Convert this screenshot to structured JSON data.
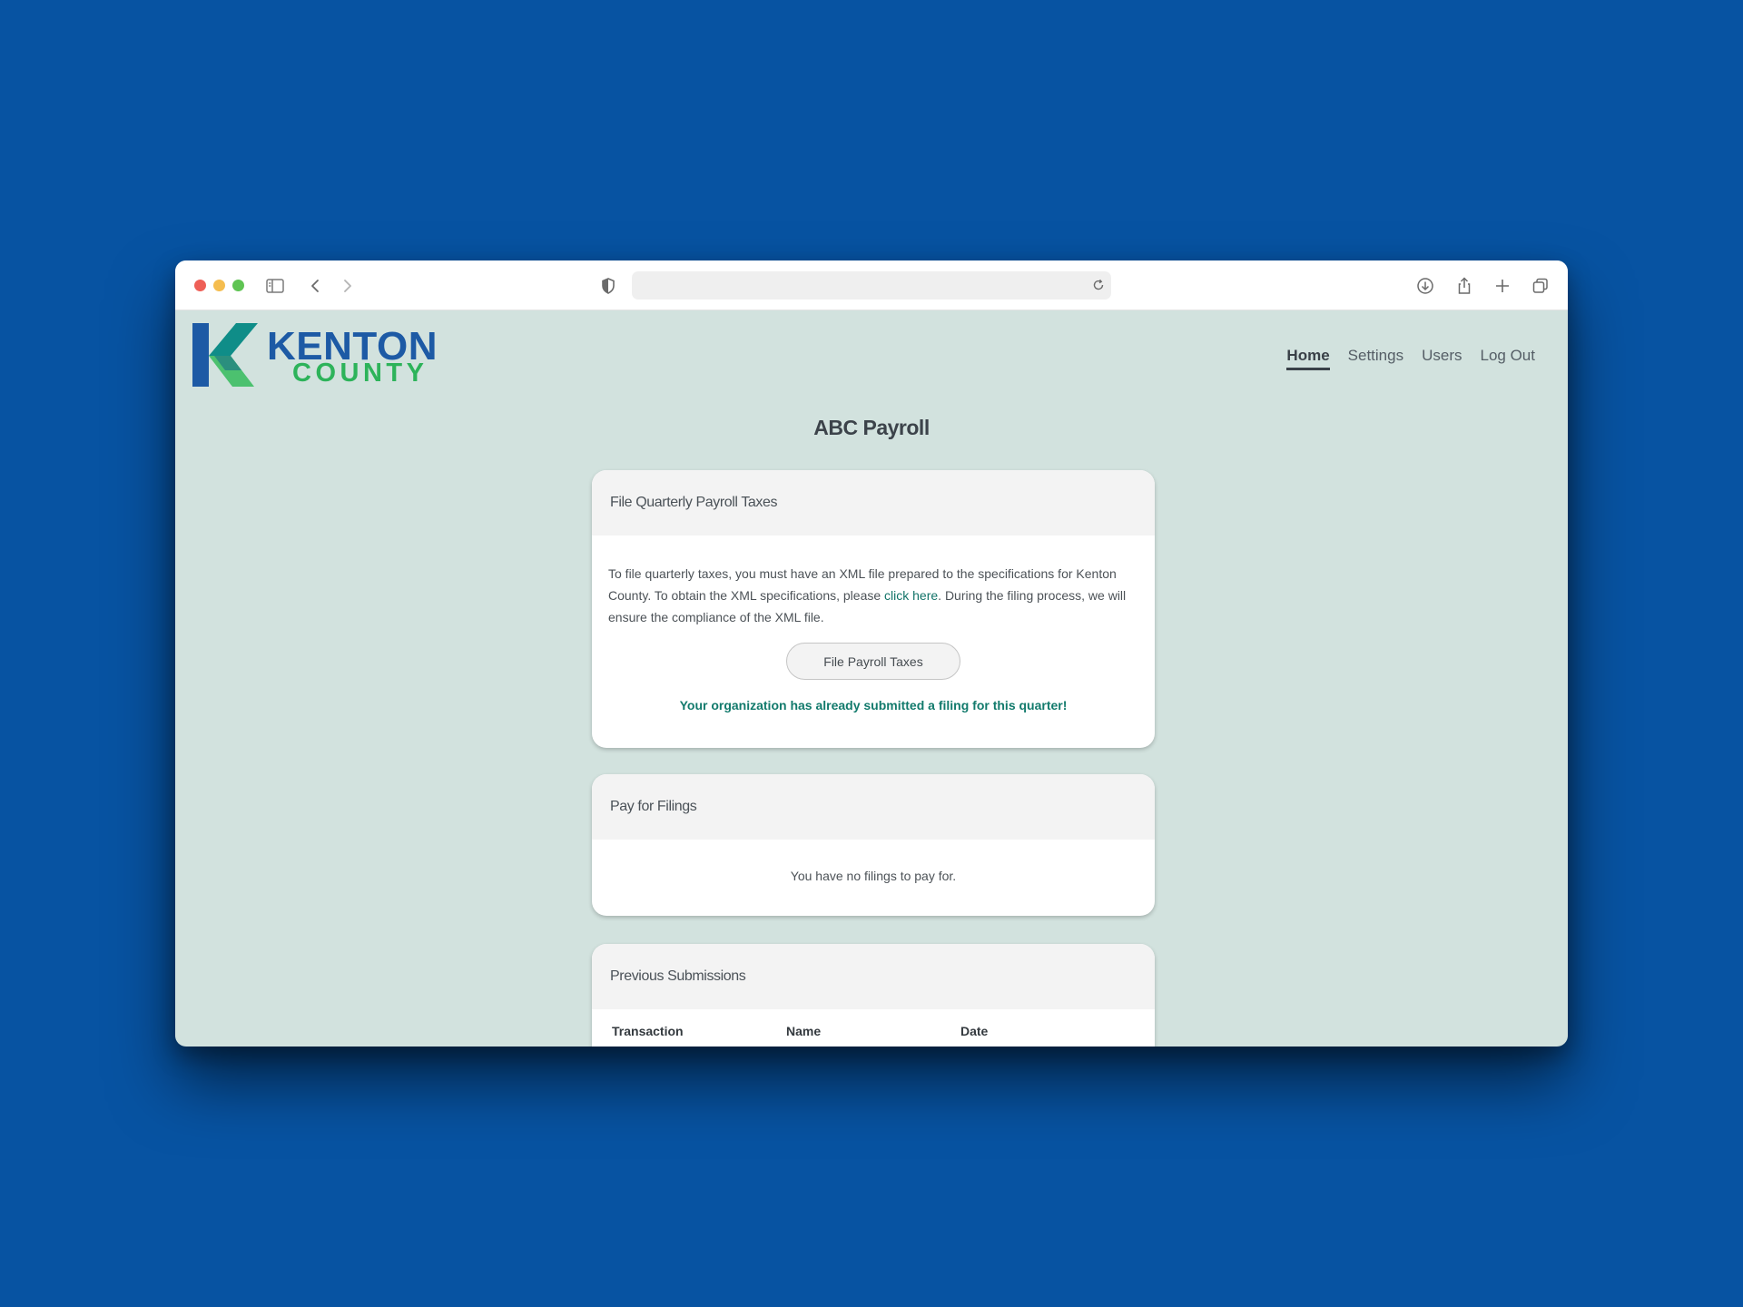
{
  "browser": {
    "url": "",
    "icons": [
      "sidebar-icon",
      "back-icon",
      "forward-icon",
      "shield-icon",
      "reload-icon",
      "download-icon",
      "share-icon",
      "new-tab-icon",
      "tabs-overview-icon"
    ]
  },
  "logo": {
    "line1": "KENTON",
    "line2": "COUNTY",
    "colors": {
      "blue": "#1d5aa5",
      "green": "#2db35a",
      "teal": "#0f8d88"
    }
  },
  "nav": {
    "home": "Home",
    "settings": "Settings",
    "users": "Users",
    "logout": "Log Out"
  },
  "page": {
    "title": "ABC Payroll"
  },
  "file_taxes": {
    "header": "File Quarterly Payroll Taxes",
    "text_before": "To file quarterly taxes, you must have an XML file prepared to the specifications for Kenton County. To obtain the XML specifications, please ",
    "link": "click here",
    "text_after": ". During the filing process, we will ensure the compliance of the XML file.",
    "button": "File Payroll Taxes",
    "status": "Your organization has already submitted a filing for this quarter!"
  },
  "pay_filings": {
    "header": "Pay for Filings",
    "message": "You have no filings to pay for."
  },
  "previous": {
    "header": "Previous Submissions",
    "columns": [
      "Transaction",
      "Name",
      "Date"
    ]
  },
  "colors": {
    "background": "#0753a2",
    "page_bg": "#d2e2de",
    "accent": "#127a6c"
  }
}
